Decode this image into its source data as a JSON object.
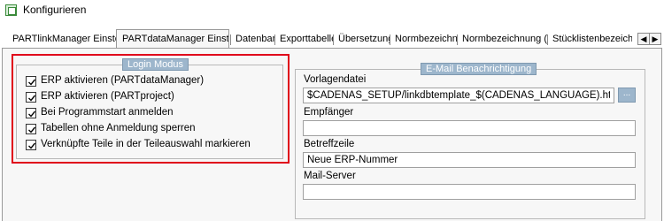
{
  "window": {
    "title": "Konfigurieren"
  },
  "tabs": [
    {
      "label": "PARTlinkManager Einstellungen"
    },
    {
      "label": "PARTdataManager Einstellungen"
    },
    {
      "label": "Datenbank"
    },
    {
      "label": "Exporttabellen"
    },
    {
      "label": "Übersetzungen"
    },
    {
      "label": "Normbezeichnung"
    },
    {
      "label": "Normbezeichnung (kurz)"
    },
    {
      "label": "Stücklistenbezeichnung"
    }
  ],
  "tab_scroll": {
    "left_glyph": "◀",
    "right_glyph": "▶"
  },
  "login_group": {
    "title": "Login Modus",
    "options": [
      {
        "label": "ERP aktivieren (PARTdataManager)",
        "checked": true
      },
      {
        "label": "ERP aktivieren (PARTproject)",
        "checked": true
      },
      {
        "label": "Bei Programmstart anmelden",
        "checked": true
      },
      {
        "label": "Tabellen ohne Anmeldung sperren",
        "checked": true
      },
      {
        "label": "Verknüpfte Teile in der Teileauswahl markieren",
        "checked": true
      }
    ]
  },
  "email_group": {
    "title": "E-Mail Benachrichtigung",
    "template_label": "Vorlagendatei",
    "template_value": "$CADENAS_SETUP/linkdbtemplate_$(CADENAS_LANGUAGE).html",
    "browse_label": "...",
    "recipient_label": "Empfänger",
    "recipient_value": "",
    "subject_label": "Betreffzeile",
    "subject_value": "Neue ERP-Nummer",
    "server_label": "Mail-Server",
    "server_value": ""
  },
  "colors": {
    "group_title_bg": "#9db6cc",
    "highlight": "#e0001a",
    "panel_bg": "#f7f7f7"
  }
}
